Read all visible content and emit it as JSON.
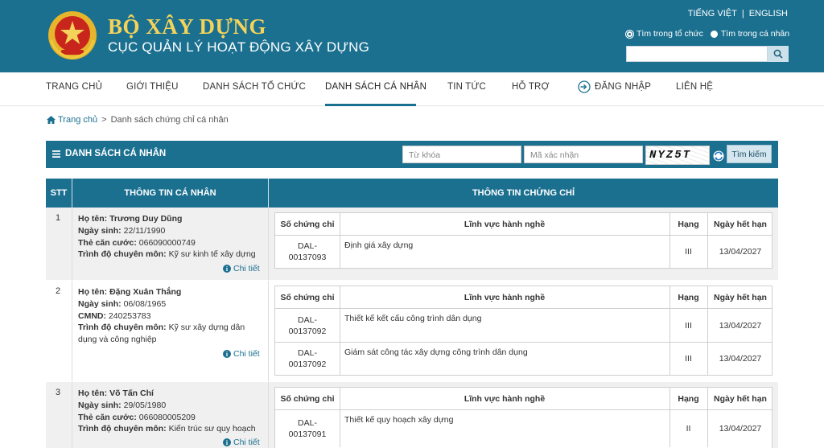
{
  "header": {
    "title": "BỘ XÂY DỰNG",
    "subtitle": "CỤC QUẢN LÝ HOẠT ĐỘNG XÂY DỰNG",
    "lang_vi": "TIẾNG VIỆT",
    "lang_sep": "|",
    "lang_en": "ENGLISH",
    "radio_org": "Tìm trong tổ chức",
    "radio_person": "Tìm trong cá nhân",
    "colors": {
      "header_bg": "#1b7090",
      "title": "#f5d35a"
    }
  },
  "nav": {
    "items": [
      "TRANG CHỦ",
      "GIỚI THIỆU",
      "DANH SÁCH TỔ CHỨC",
      "DANH SÁCH CÁ NHÂN",
      "TIN TỨC",
      "HỖ TRỢ",
      "ĐĂNG NHẬP",
      "LIÊN HỆ"
    ],
    "active": "DANH SÁCH CÁ NHÂN"
  },
  "breadcrumb": {
    "home": "Trang chủ",
    "sep": ">",
    "current": "Danh sách chứng chỉ cá nhân"
  },
  "list": {
    "title": "DANH SÁCH CÁ NHÂN",
    "keyword_placeholder": "Từ khóa",
    "captcha_placeholder": "Mã xác nhận",
    "captcha_text": "NYZ5T",
    "search_button": "Tìm kiếm"
  },
  "table": {
    "headers": {
      "stt": "STT",
      "personal": "THÔNG TIN CÁ NHÂN",
      "cert": "THÔNG TIN CHỨNG CHỈ"
    },
    "inner_headers": {
      "no": "Số chứng chỉ",
      "field": "Lĩnh vực hành nghề",
      "rank": "Hạng",
      "expiry": "Ngày hết hạn"
    },
    "detail_label": "Chi tiết",
    "rows": [
      {
        "stt": "1",
        "name_label": "Họ tên:",
        "name": "Trương Duy Dũng",
        "dob_label": "Ngày sinh:",
        "dob": "22/11/1990",
        "id_label": "Thẻ căn cước:",
        "id": "066090000749",
        "edu_label": "Trình độ chuyên môn:",
        "edu": "Kỹ sư kinh tế xây dựng",
        "certs": [
          {
            "no": "DAL-00137093",
            "field": "Định giá xây dựng",
            "rank": "III",
            "expiry": "13/04/2027"
          }
        ]
      },
      {
        "stt": "2",
        "name_label": "Họ tên:",
        "name": "Đặng Xuân Thắng",
        "dob_label": "Ngày sinh:",
        "dob": "06/08/1965",
        "id_label": "CMND:",
        "id": "240253783",
        "edu_label": "Trình độ chuyên môn:",
        "edu": "Kỹ sư xây dựng dân dụng và công nghiệp",
        "certs": [
          {
            "no": "DAL-00137092",
            "field": "Thiết kế kết cấu công trình dân dụng",
            "rank": "III",
            "expiry": "13/04/2027"
          },
          {
            "no": "DAL-00137092",
            "field": "Giám sát công tác xây dựng công trình dân dụng",
            "rank": "III",
            "expiry": "13/04/2027"
          }
        ]
      },
      {
        "stt": "3",
        "name_label": "Họ tên:",
        "name": "Võ Tấn Chí",
        "dob_label": "Ngày sinh:",
        "dob": "29/05/1980",
        "id_label": "Thẻ căn cước:",
        "id": "066080005209",
        "edu_label": "Trình độ chuyên môn:",
        "edu": "Kiến trúc sư quy hoạch",
        "certs": [
          {
            "no": "DAL-00137091",
            "field": "Thiết kế quy hoạch xây dựng",
            "rank": "II",
            "expiry": "13/04/2027"
          }
        ]
      }
    ]
  }
}
